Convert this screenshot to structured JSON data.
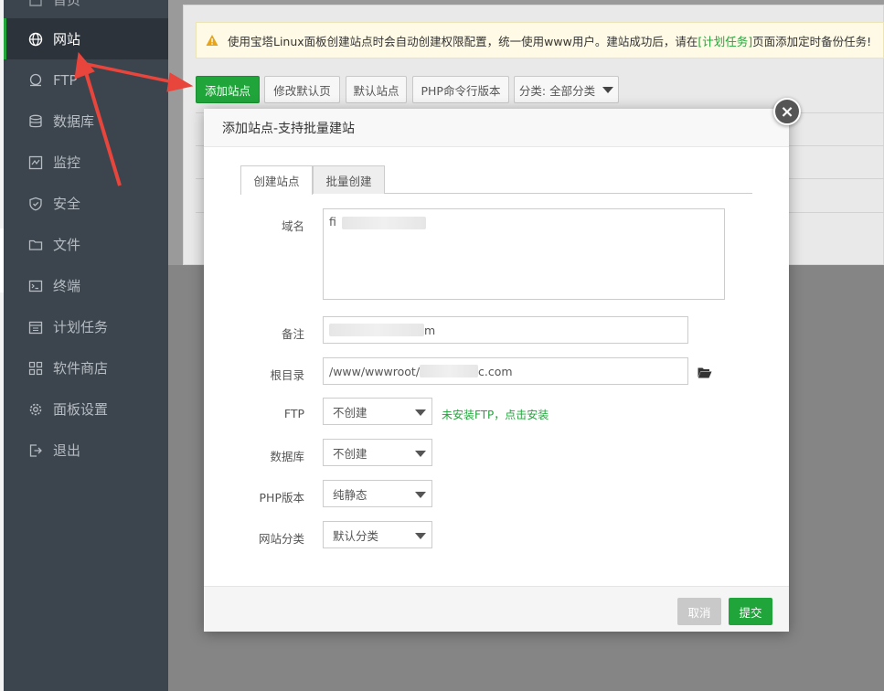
{
  "sidebar": {
    "items": [
      {
        "label": "首页",
        "icon": "home-icon"
      },
      {
        "label": "网站",
        "icon": "globe-icon"
      },
      {
        "label": "FTP",
        "icon": "ftp-icon"
      },
      {
        "label": "数据库",
        "icon": "database-icon"
      },
      {
        "label": "监控",
        "icon": "monitor-icon"
      },
      {
        "label": "安全",
        "icon": "shield-icon"
      },
      {
        "label": "文件",
        "icon": "folder-icon"
      },
      {
        "label": "终端",
        "icon": "terminal-icon"
      },
      {
        "label": "计划任务",
        "icon": "calendar-icon"
      },
      {
        "label": "软件商店",
        "icon": "apps-icon"
      },
      {
        "label": "面板设置",
        "icon": "gear-icon"
      },
      {
        "label": "退出",
        "icon": "logout-icon"
      }
    ]
  },
  "notice": {
    "text_before": "使用宝塔Linux面板创建站点时会自动创建权限配置，统一使用www用户。建站成功后，请在",
    "link": "[计划任务]",
    "text_after": "页面添加定时备份任务!"
  },
  "toolbar": {
    "add_site": "添加站点",
    "edit_default_page": "修改默认页",
    "default_site": "默认站点",
    "php_cli_version": "PHP命令行版本",
    "category_filter": "分类: 全部分类"
  },
  "modal": {
    "title": "添加站点-支持批量建站",
    "tabs": [
      "创建站点",
      "批量创建"
    ],
    "fields": {
      "domain_label": "域名",
      "domain_value": "fi",
      "remark_label": "备注",
      "remark_suffix": "m",
      "root_label": "根目录",
      "root_prefix": "/www/wwwroot/",
      "root_suffix": "c.com",
      "ftp_label": "FTP",
      "ftp_value": "不创建",
      "ftp_hint": "未安装FTP，点击安装",
      "db_label": "数据库",
      "db_value": "不创建",
      "php_label": "PHP版本",
      "php_value": "纯静态",
      "category_label": "网站分类",
      "category_value": "默认分类"
    },
    "cancel": "取消",
    "submit": "提交",
    "close": "×"
  },
  "colors": {
    "brand_green": "#20a53a",
    "sidebar_bg": "#3c444d",
    "annotation_red": "#e8453c"
  }
}
